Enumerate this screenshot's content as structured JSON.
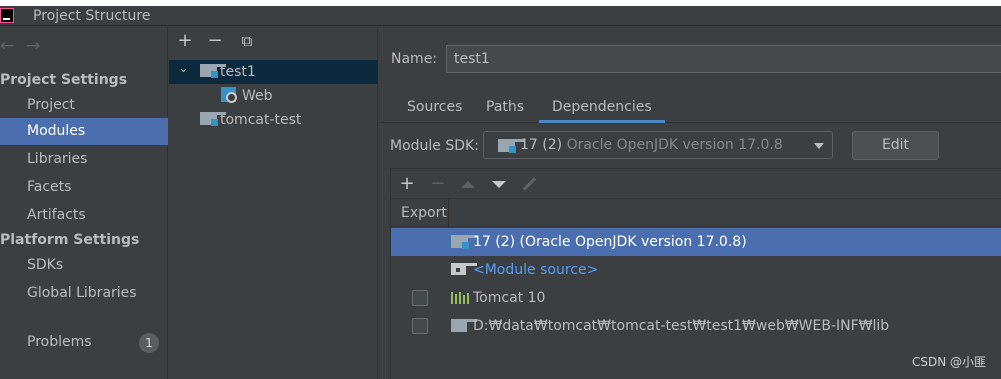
{
  "window": {
    "title": "Project Structure"
  },
  "left_nav": {
    "back_arrow": "←",
    "forward_arrow": "→",
    "sections": [
      {
        "title": "Project Settings",
        "items": [
          "Project",
          "Modules",
          "Libraries",
          "Facets",
          "Artifacts"
        ]
      },
      {
        "title": "Platform Settings",
        "items": [
          "SDKs",
          "Global Libraries"
        ]
      }
    ],
    "selected_item": "Modules",
    "problems": {
      "label": "Problems",
      "count": "1"
    }
  },
  "module_tree": {
    "toolbar": {
      "add": "+",
      "remove": "−",
      "copy": "⧉"
    },
    "expander": "⌄",
    "nodes": [
      {
        "label": "test1",
        "icon": "module-folder-icon",
        "selected": true
      },
      {
        "label": "Web",
        "icon": "web-facet-icon"
      },
      {
        "label": "tomcat-test",
        "icon": "module-folder-icon"
      }
    ]
  },
  "details": {
    "name_label": "Name:",
    "name_value": "test1",
    "tabs": [
      "Sources",
      "Paths",
      "Dependencies"
    ],
    "active_tab": "Dependencies",
    "sdk_label": "Module SDK:",
    "sdk_value": "17 (2)",
    "sdk_desc": "Oracle OpenJDK version 17.0.8",
    "edit_button": "Edit"
  },
  "dependencies": {
    "toolbar": {
      "add": "+",
      "remove": "−"
    },
    "header_export": "Export",
    "rows": [
      {
        "text": "17 (2) (Oracle OpenJDK version 17.0.8)",
        "icon": "jdk-folder-icon",
        "selected": true,
        "checkbox": false
      },
      {
        "text": "<Module source>",
        "icon": "module-source-icon",
        "link": true,
        "checkbox": false
      },
      {
        "text": "Tomcat 10",
        "icon": "library-icon",
        "checkbox": true
      },
      {
        "text": "D:₩data₩tomcat₩tomcat-test₩test1₩web₩WEB-INF₩lib",
        "icon": "folder-icon",
        "checkbox": true
      }
    ]
  },
  "colors": {
    "background": "#3c3f41",
    "selection": "#4b6eaf",
    "tree_selection": "#0d293e",
    "link": "#589df6",
    "accent_tab": "#4a88c7"
  },
  "watermark": "CSDN @小匪"
}
